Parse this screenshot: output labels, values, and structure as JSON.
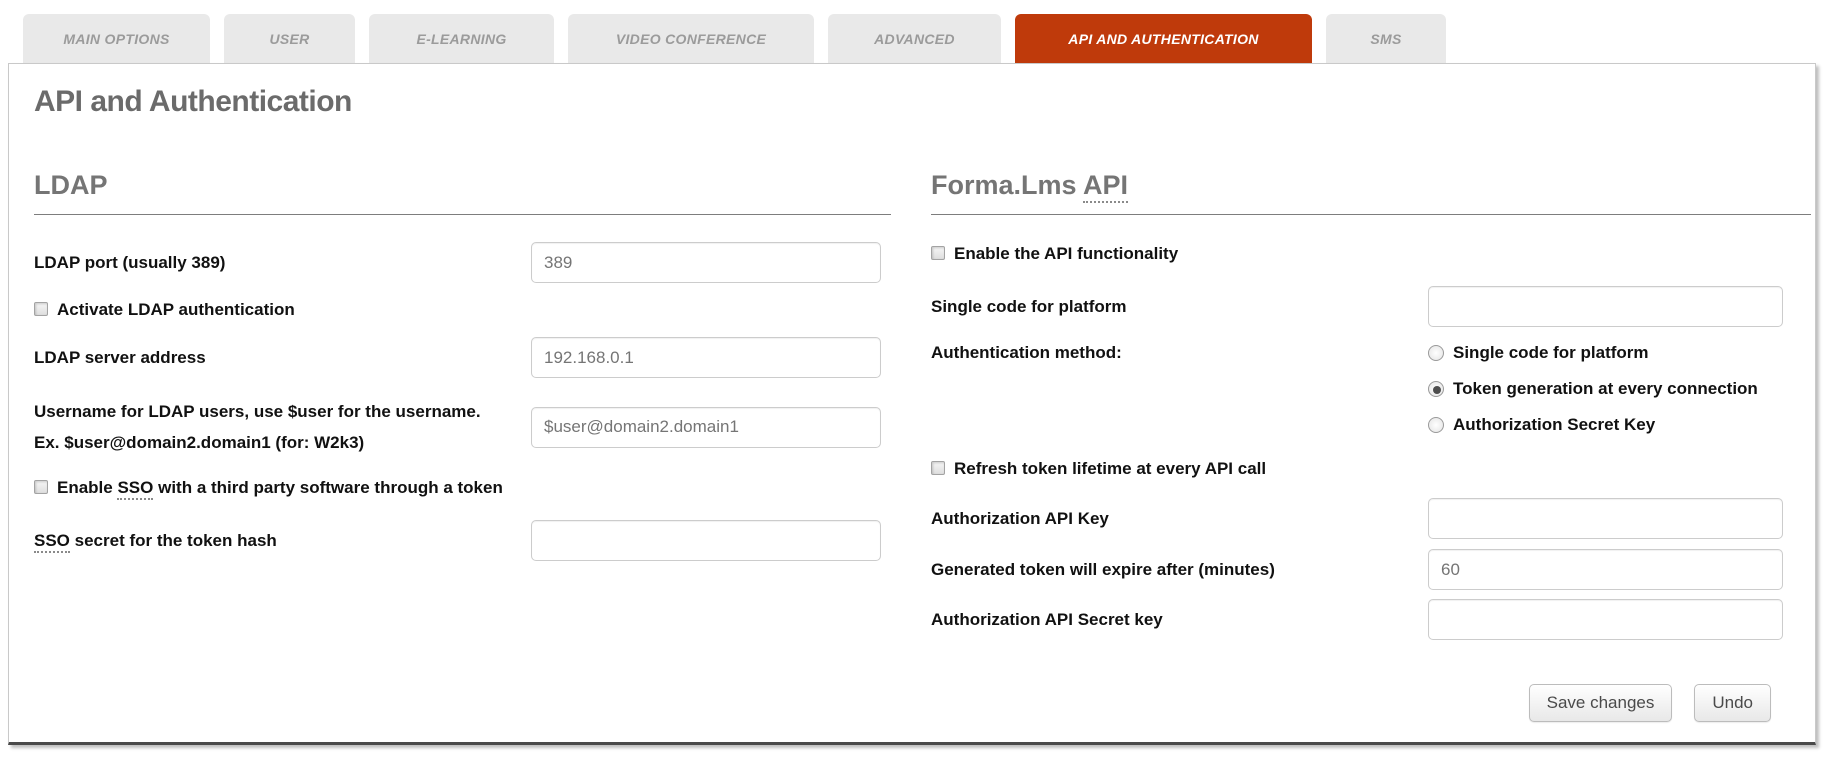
{
  "colors": {
    "accent": "#bf3a0b",
    "tab_inactive_bg": "#e9e9e9",
    "tab_inactive_text": "#9b9b9b"
  },
  "tabs": [
    {
      "label": "MAIN OPTIONS",
      "active": false
    },
    {
      "label": "USER",
      "active": false
    },
    {
      "label": "E-LEARNING",
      "active": false
    },
    {
      "label": "VIDEO CONFERENCE",
      "active": false
    },
    {
      "label": "ADVANCED",
      "active": false
    },
    {
      "label": "API AND AUTHENTICATION",
      "active": true
    },
    {
      "label": "SMS",
      "active": false
    }
  ],
  "page_title": "API and Authentication",
  "ldap": {
    "section_title": "LDAP",
    "port_label": "LDAP port (usually 389)",
    "port_value": "389",
    "activate_checkbox_label": "Activate LDAP authentication",
    "activate_checked": false,
    "server_label": "LDAP server address",
    "server_value": "192.168.0.1",
    "username_label_line1": "Username for LDAP users, use $user for the username.",
    "username_label_line2": "Ex. $user@domain2.domain1 (for: W2k3)",
    "username_value": "$user@domain2.domain1",
    "sso_checkbox": {
      "pre": "Enable ",
      "abbr": "SSO",
      "post": " with a third party software through a token"
    },
    "sso_checked": false,
    "sso_secret": {
      "abbr": "SSO",
      "post": " secret for the token hash"
    },
    "sso_secret_value": ""
  },
  "api": {
    "section_title": {
      "pre": "Forma.Lms ",
      "abbr": "API"
    },
    "enable_checkbox_label": "Enable the API functionality",
    "enable_checked": false,
    "single_code_label": "Single code for platform",
    "single_code_value": "",
    "auth_method_label": "Authentication method:",
    "auth_methods": [
      {
        "label": "Single code for platform",
        "selected": false
      },
      {
        "label": "Token generation at every connection",
        "selected": true
      },
      {
        "label": "Authorization Secret Key",
        "selected": false
      }
    ],
    "refresh_checkbox_label": "Refresh token lifetime at every API call",
    "refresh_checked": false,
    "api_key_label": "Authorization API Key",
    "api_key_value": "",
    "expire_label": "Generated token will expire after (minutes)",
    "expire_value": "60",
    "secret_key_label": "Authorization API Secret key",
    "secret_key_value": ""
  },
  "buttons": {
    "save": "Save changes",
    "undo": "Undo"
  }
}
